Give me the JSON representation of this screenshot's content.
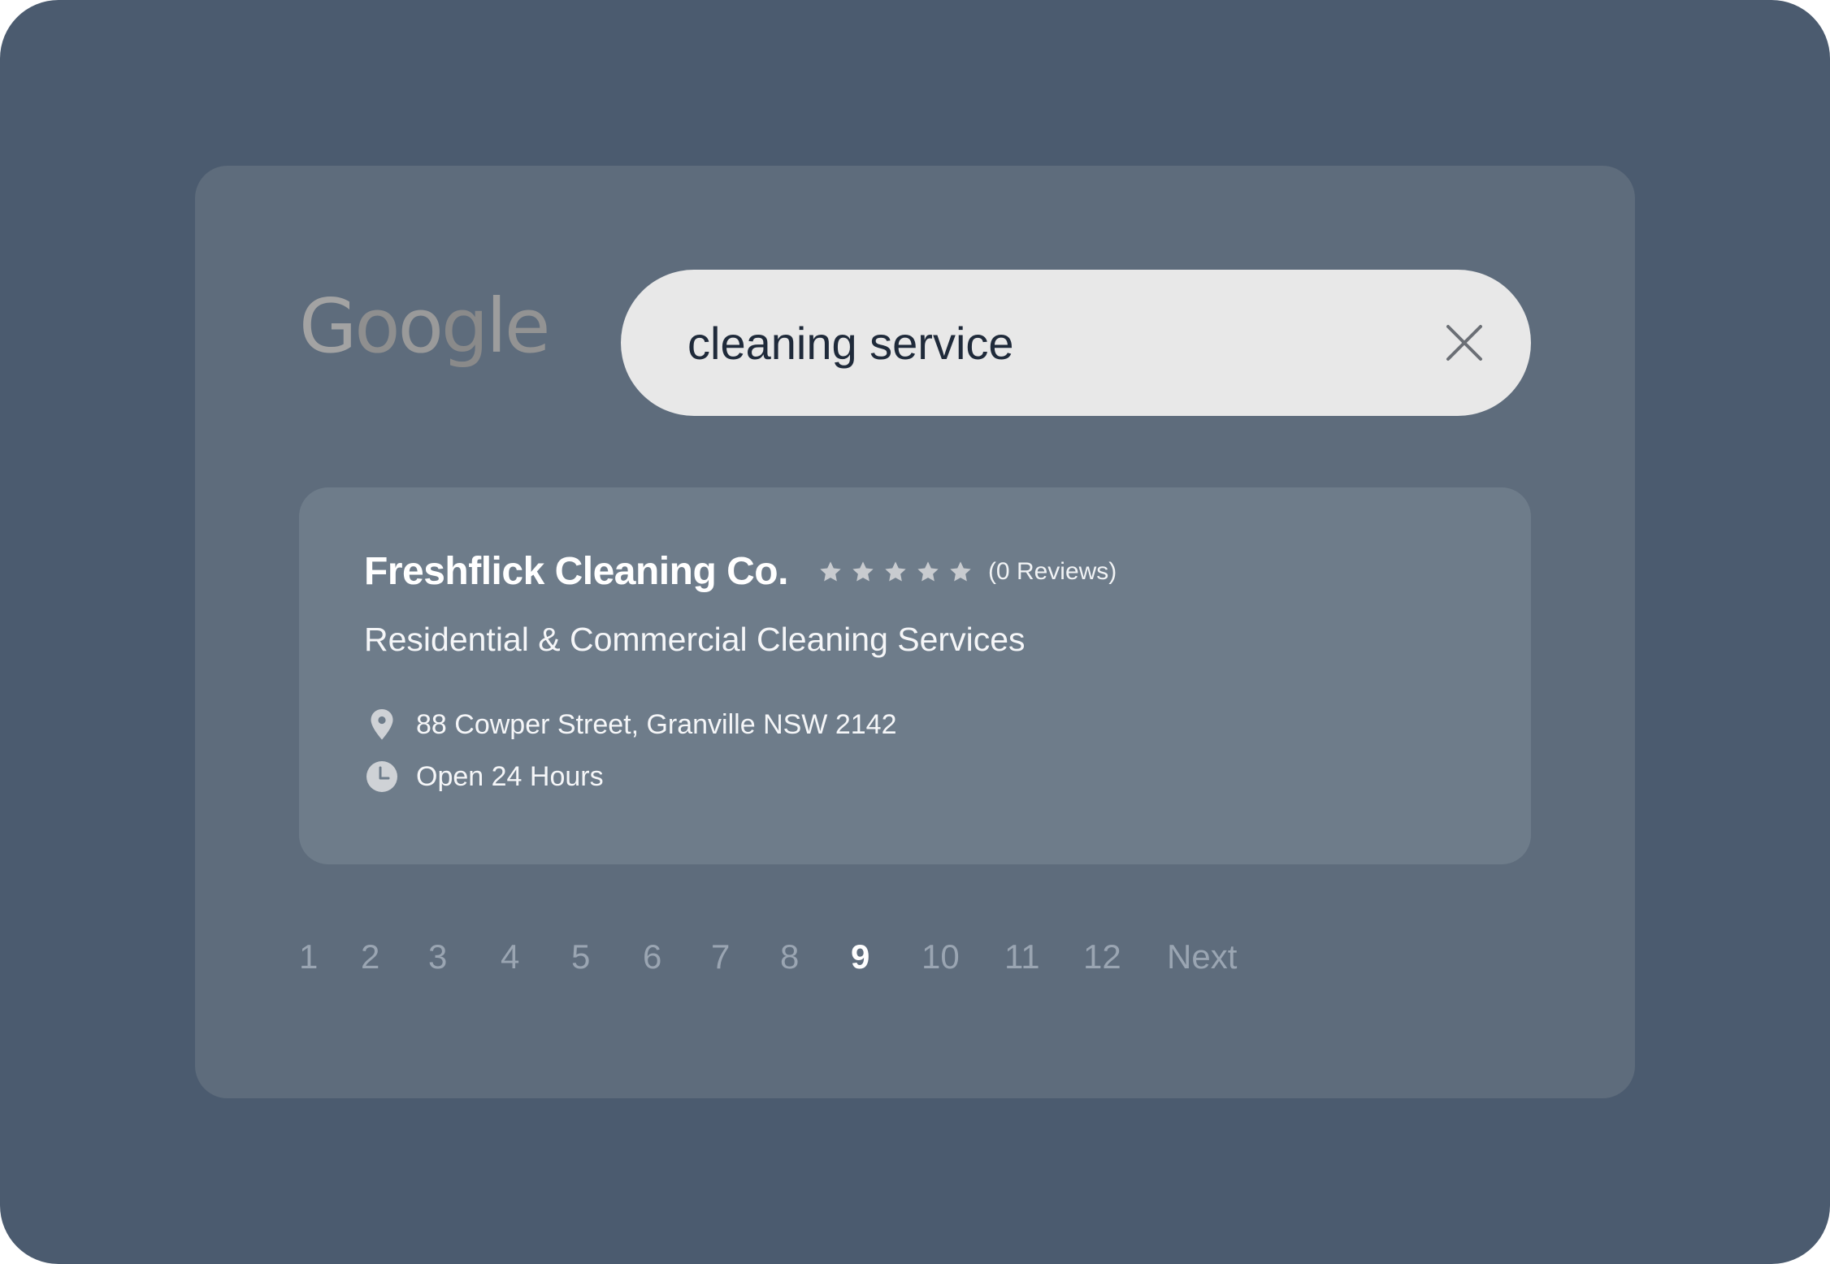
{
  "logo": {
    "text": "Google",
    "letters": [
      "G",
      "o",
      "o",
      "g",
      "l",
      "e"
    ]
  },
  "search": {
    "value": "cleaning service",
    "clear_icon": "close-icon"
  },
  "result": {
    "business_name": "Freshflick Cleaning Co.",
    "rating": 0,
    "max_rating": 5,
    "reviews_text": "(0 Reviews)",
    "description": "Residential & Commercial Cleaning Services",
    "address": "88 Cowper Street, Granville NSW 2142",
    "address_icon": "location-pin-icon",
    "hours": "Open 24 Hours",
    "hours_icon": "clock-icon"
  },
  "pagination": {
    "pages": [
      "1",
      "2",
      "3",
      "4",
      "5",
      "6",
      "7",
      "8",
      "9",
      "10",
      "11",
      "12"
    ],
    "current_page": "9",
    "next_label": "Next"
  },
  "colors": {
    "background": "#4b5b6f",
    "panel": "#5e6c7c",
    "card": "#6e7c8a",
    "search_bar": "#e8e8e8",
    "muted_text": "#9aa5b2",
    "star": "#c8cbcf"
  }
}
